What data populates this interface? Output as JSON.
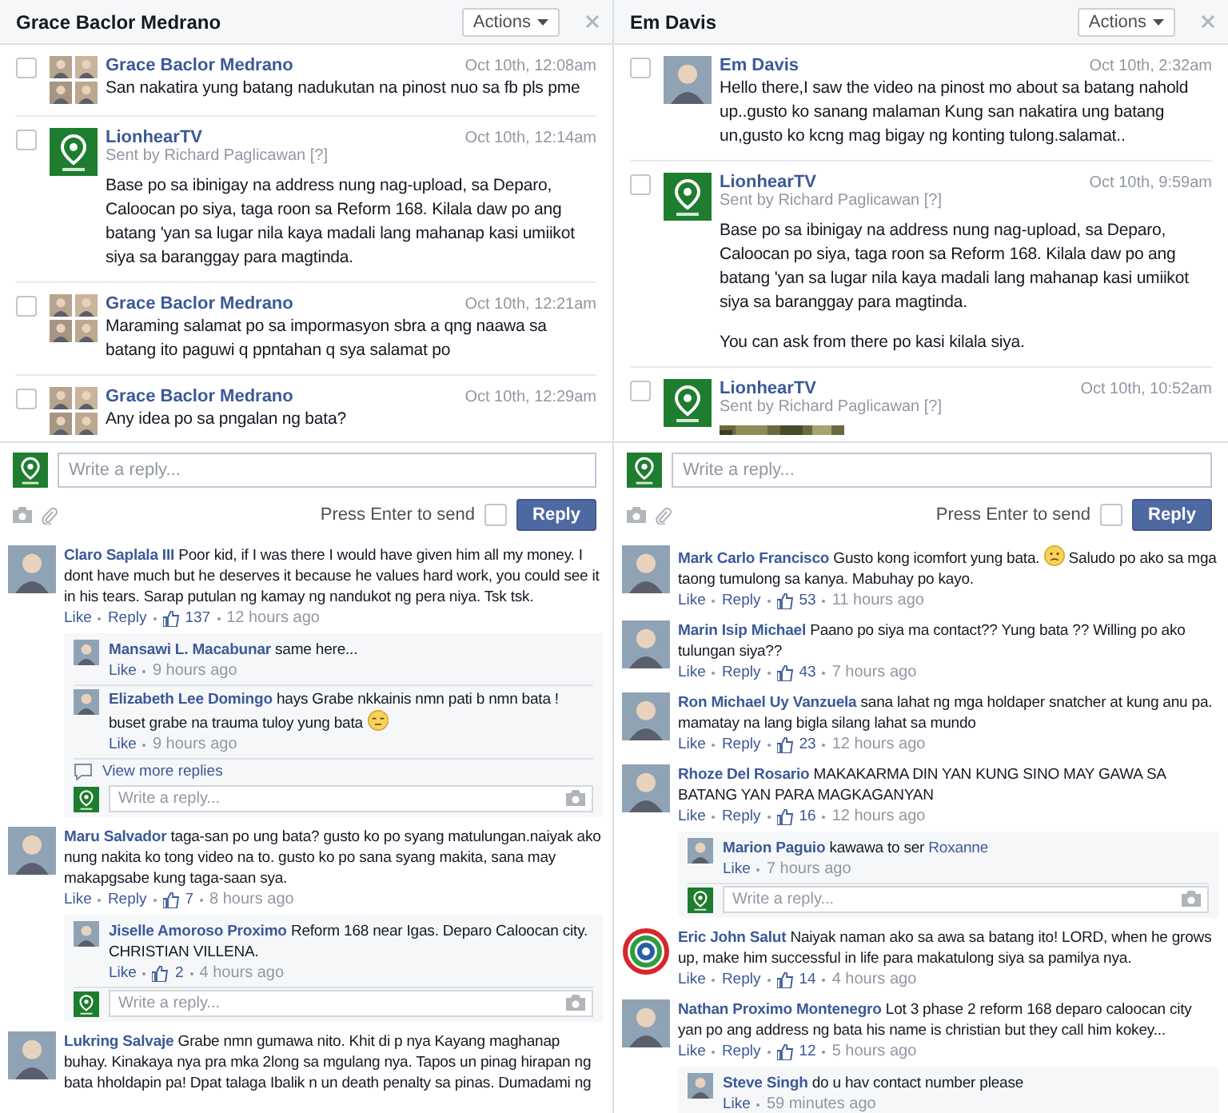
{
  "panels": [
    {
      "title": "Grace Baclor Medrano",
      "actions_label": "Actions",
      "messages": [
        {
          "author": "Grace Baclor Medrano",
          "avatar": {
            "kind": "group"
          },
          "checked": false,
          "time": "Oct 10th, 12:08am",
          "paragraphs": [
            "San nakatira yung batang nadukutan na pinost nuo sa fb pls pme"
          ]
        },
        {
          "author": "LionhearTV",
          "avatar": {
            "kind": "page"
          },
          "checked": false,
          "sent_by": "Sent by Richard Paglicawan",
          "help": "[?]",
          "time": "Oct 10th, 12:14am",
          "paragraphs": [
            "Base po sa ibinigay na address nung nag-upload, sa Deparo, Caloocan po siya, taga roon sa Reform 168. Kilala daw po ang batang 'yan sa lugar nila kaya madali lang mahanap kasi umiikot siya sa baranggay para magtinda."
          ]
        },
        {
          "author": "Grace Baclor Medrano",
          "avatar": {
            "kind": "group"
          },
          "checked": false,
          "time": "Oct 10th, 12:21am",
          "paragraphs": [
            "Maraming salamat po sa impormasyon sbra a qng naawa sa batang ito paguwi q ppntahan q sya salamat po"
          ]
        },
        {
          "author": "Grace Baclor Medrano",
          "avatar": {
            "kind": "group"
          },
          "checked": false,
          "time": "Oct 10th, 12:29am",
          "paragraphs": [
            "Any idea po sa pngalan ng bata?"
          ]
        }
      ],
      "composer": {
        "placeholder": "Write a reply...",
        "send_hint": "Press Enter to send",
        "enter_to_send": false,
        "button": "Reply"
      },
      "comments": [
        {
          "author": "Claro Saplala III",
          "avatar": {
            "kind": "person"
          },
          "text": "Poor kid, if I was there I would have given him all my money. I dont have much but he deserves it because he values hard work, you could see it in his tears. Sarap putulan ng kamay ng nandukot ng pera niya. Tsk tsk.",
          "actions": [
            "Like",
            "Reply"
          ],
          "likes": "137",
          "time": "12 hours ago",
          "replies": [
            {
              "author": "Mansawi L. Macabunar",
              "text": "same here...",
              "actions": [
                "Like"
              ],
              "time": "9 hours ago"
            },
            {
              "author": "Elizabeth Lee Domingo",
              "text": "hays Grabe nkkainis nmn pati b nmn bata ! buset grabe na trauma tuloy yung bata",
              "emoji": {
                "kind": "unamused"
              },
              "actions": [
                "Like"
              ],
              "time": "9 hours ago"
            }
          ],
          "more_replies": "View more replies",
          "reply_placeholder": "Write a reply..."
        },
        {
          "author": "Maru Salvador",
          "avatar": {
            "kind": "person"
          },
          "text": "taga-san po ung bata? gusto ko po syang matulungan.naiyak ako nung nakita ko tong video na to. gusto ko po sana syang makita, sana may makapgsabe kung taga-saan sya.",
          "actions": [
            "Like",
            "Reply"
          ],
          "likes": "7",
          "time": "8 hours ago",
          "replies": [
            {
              "author": "Jiselle Amoroso Proximo",
              "text": "Reform 168 near Igas. Deparo Caloocan city. CHRISTIAN VILLENA.",
              "actions": [
                "Like"
              ],
              "likes": "2",
              "time": "4 hours ago"
            }
          ],
          "reply_placeholder": "Write a reply..."
        },
        {
          "author": "Lukring Salvaje",
          "avatar": {
            "kind": "person"
          },
          "text": "Grabe nmn gumawa nito. Khit di p nya Kayang maghanap buhay. Kinakaya nya pra mka 2long sa mgulang nya. Tapos un pinag hirapan ng bata hholdapin pa! Dpat talaga Ibalik n un death penalty sa pinas. Dumadami ng"
        }
      ]
    },
    {
      "title": "Em Davis",
      "actions_label": "Actions",
      "messages": [
        {
          "author": "Em Davis",
          "avatar": {
            "kind": "person"
          },
          "checked": false,
          "time": "Oct 10th, 2:32am",
          "paragraphs": [
            "Hello there,I saw the video na pinost mo about sa batang nahold up..gusto ko sanang malaman Kung san nakatira ung batang un,gusto ko kcng mag bigay ng konting tulong.salamat.."
          ]
        },
        {
          "author": "LionhearTV",
          "avatar": {
            "kind": "page"
          },
          "checked": false,
          "sent_by": "Sent by Richard Paglicawan",
          "help": "[?]",
          "time": "Oct 10th, 9:59am",
          "paragraphs": [
            "Base po sa ibinigay na address nung nag-upload, sa Deparo, Caloocan po siya, taga roon sa Reform 168. Kilala daw po ang batang 'yan sa lugar nila kaya madali lang mahanap kasi umiikot siya sa baranggay para magtinda.",
            "You can ask from there po kasi kilala siya."
          ]
        },
        {
          "author": "LionhearTV",
          "avatar": {
            "kind": "page"
          },
          "checked": false,
          "sent_by": "Sent by Richard Paglicawan",
          "help": "[?]",
          "time": "Oct 10th, 10:52am"
        }
      ],
      "composer": {
        "placeholder": "Write a reply...",
        "send_hint": "Press Enter to send",
        "enter_to_send": false,
        "button": "Reply"
      },
      "comments": [
        {
          "author": "Mark Carlo Francisco",
          "avatar": {
            "kind": "person"
          },
          "text": "Gusto kong icomfort yung bata.",
          "emoji": {
            "kind": "frown"
          },
          "text_after": "Saludo po ako sa mga taong tumulong sa kanya. Mabuhay po kayo.",
          "actions": [
            "Like",
            "Reply"
          ],
          "likes": "53",
          "time": "11 hours ago"
        },
        {
          "author": "Marin Isip Michael",
          "avatar": {
            "kind": "person"
          },
          "text": "Paano po siya ma contact?? Yung bata ?? Willing po ako tulungan siya??",
          "actions": [
            "Like",
            "Reply"
          ],
          "likes": "43",
          "time": "7 hours ago"
        },
        {
          "author": "Ron Michael Uy Vanzuela",
          "avatar": {
            "kind": "person"
          },
          "text": "sana lahat ng mga holdaper snatcher at kung anu pa. mamatay na lang bigla silang lahat sa mundo",
          "actions": [
            "Like",
            "Reply"
          ],
          "likes": "23",
          "time": "12 hours ago"
        },
        {
          "author": "Rhoze Del Rosario",
          "avatar": {
            "kind": "person"
          },
          "text": "MAKAKARMA DIN YAN KUNG SINO MAY GAWA SA BATANG YAN PARA MAGKAGANYAN",
          "actions": [
            "Like",
            "Reply"
          ],
          "likes": "16",
          "time": "12 hours ago",
          "replies": [
            {
              "author": "Marion Paguio",
              "text": "kawawa to ser",
              "mention": "Roxanne",
              "actions": [
                "Like"
              ],
              "time": "7 hours ago"
            }
          ],
          "reply_placeholder": "Write a reply..."
        },
        {
          "author": "Eric John Salut",
          "avatar": {
            "kind": "rings"
          },
          "text": "Naiyak naman ako sa awa sa batang ito! LORD, when he grows up, make him successful in life para makatulong siya sa pamilya nya.",
          "actions": [
            "Like",
            "Reply"
          ],
          "likes": "14",
          "time": "4 hours ago"
        },
        {
          "author": "Nathan Proximo Montenegro",
          "avatar": {
            "kind": "person"
          },
          "text": "Lot 3 phase 2 reform 168 deparo caloocan city yan po ang address ng bata his name is christian but they call him kokey...",
          "actions": [
            "Like",
            "Reply"
          ],
          "likes": "12",
          "time": "5 hours ago",
          "replies": [
            {
              "author": "Steve Singh",
              "text": "do u hav contact number please",
              "actions": [
                "Like"
              ],
              "time": "59 minutes ago"
            }
          ]
        }
      ]
    }
  ]
}
